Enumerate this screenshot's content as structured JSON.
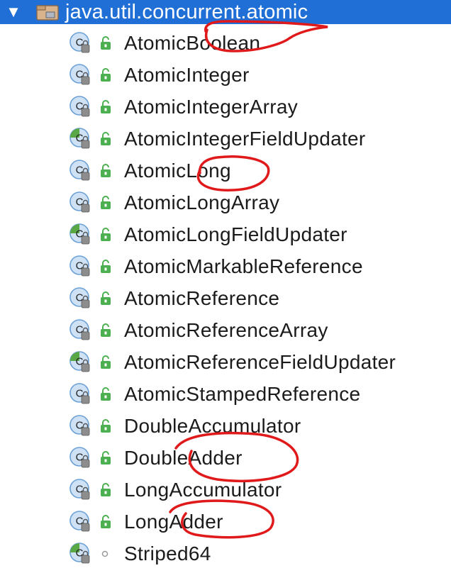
{
  "package": {
    "name": "java.util.concurrent.atomic",
    "expander": "expanded-triangle-icon",
    "icon": "package-icon"
  },
  "colors": {
    "selection": "#1f6fd6",
    "class_icon_fill": "#cfe2f5",
    "class_icon_border": "#6aa0d6",
    "abstract_marker": "#5aa845",
    "public_lock": "#4caf50",
    "annotation_ink": "#e0191b"
  },
  "classes": [
    {
      "label": "AtomicBoolean",
      "kind": "class",
      "visibility": "public",
      "annotated": true
    },
    {
      "label": "AtomicInteger",
      "kind": "class",
      "visibility": "public",
      "annotated": false
    },
    {
      "label": "AtomicIntegerArray",
      "kind": "class",
      "visibility": "public",
      "annotated": false
    },
    {
      "label": "AtomicIntegerFieldUpdater",
      "kind": "abstract-class",
      "visibility": "public",
      "annotated": false
    },
    {
      "label": "AtomicLong",
      "kind": "class",
      "visibility": "public",
      "annotated": true
    },
    {
      "label": "AtomicLongArray",
      "kind": "class",
      "visibility": "public",
      "annotated": false
    },
    {
      "label": "AtomicLongFieldUpdater",
      "kind": "abstract-class",
      "visibility": "public",
      "annotated": false
    },
    {
      "label": "AtomicMarkableReference",
      "kind": "class",
      "visibility": "public",
      "annotated": false
    },
    {
      "label": "AtomicReference",
      "kind": "class",
      "visibility": "public",
      "annotated": false
    },
    {
      "label": "AtomicReferenceArray",
      "kind": "class",
      "visibility": "public",
      "annotated": false
    },
    {
      "label": "AtomicReferenceFieldUpdater",
      "kind": "abstract-class",
      "visibility": "public",
      "annotated": false
    },
    {
      "label": "AtomicStampedReference",
      "kind": "class",
      "visibility": "public",
      "annotated": false
    },
    {
      "label": "DoubleAccumulator",
      "kind": "class",
      "visibility": "public",
      "annotated": false
    },
    {
      "label": "DoubleAdder",
      "kind": "class",
      "visibility": "public",
      "annotated": true
    },
    {
      "label": "LongAccumulator",
      "kind": "class",
      "visibility": "public",
      "annotated": false
    },
    {
      "label": "LongAdder",
      "kind": "class",
      "visibility": "public",
      "annotated": true
    },
    {
      "label": "Striped64",
      "kind": "abstract-class",
      "visibility": "package-private",
      "annotated": false
    }
  ]
}
